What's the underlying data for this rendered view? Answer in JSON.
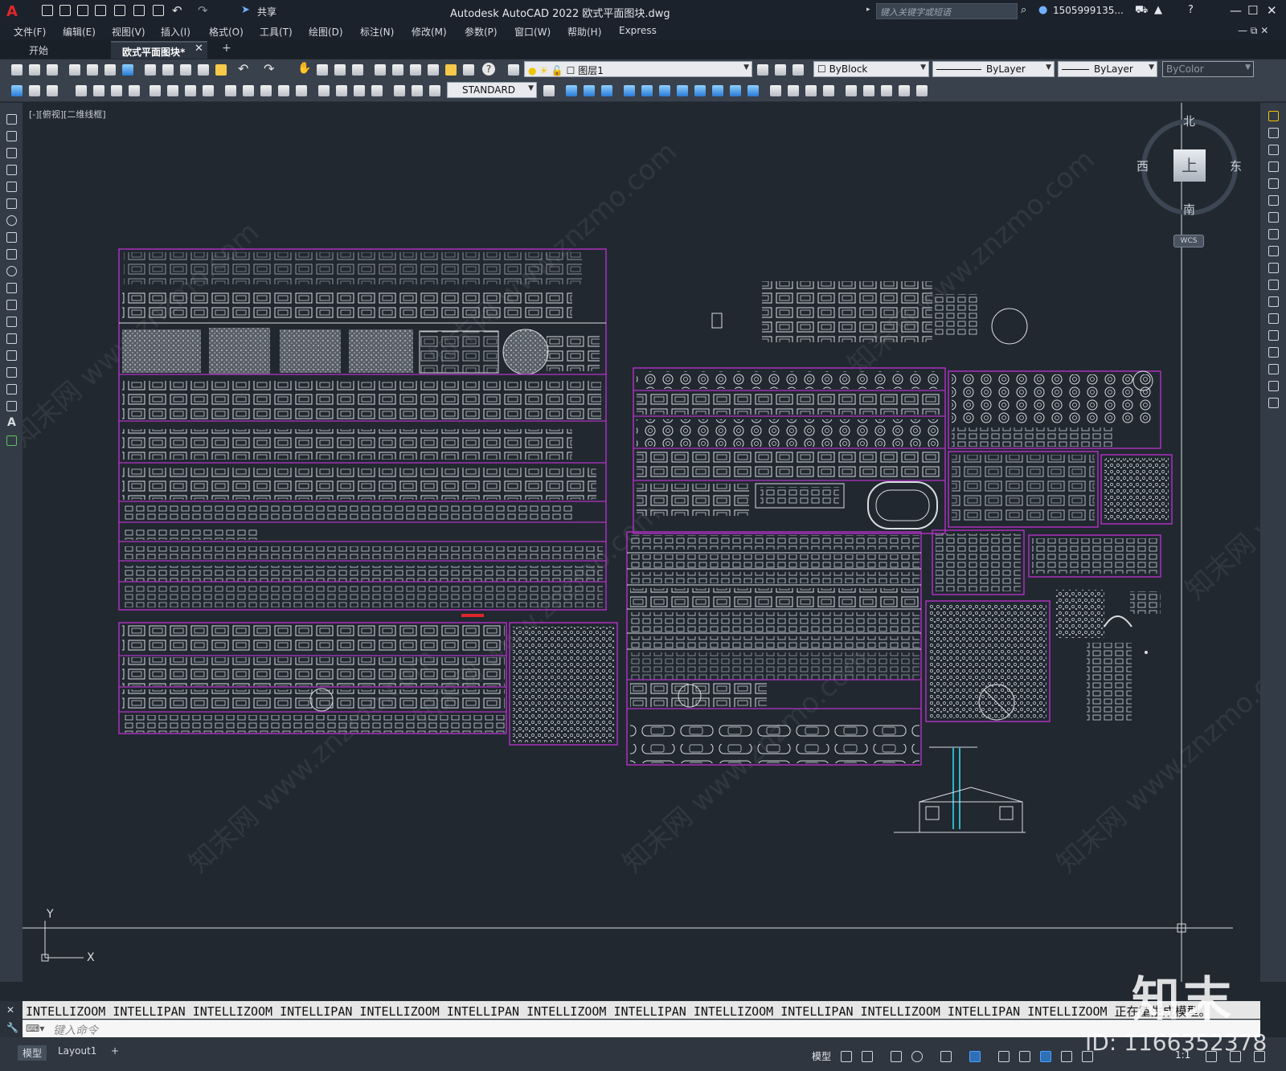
{
  "app": {
    "logo": "A",
    "title": "Autodesk AutoCAD 2022    欧式平面图块.dwg",
    "share": "共享",
    "search_placeholder": "键入关键字或短语",
    "user": "1505999135...",
    "window_buttons": [
      "—",
      "☐",
      "✕"
    ]
  },
  "menu": [
    "文件(F)",
    "编辑(E)",
    "视图(V)",
    "插入(I)",
    "格式(O)",
    "工具(T)",
    "绘图(D)",
    "标注(N)",
    "修改(M)",
    "参数(P)",
    "窗口(W)",
    "帮助(H)",
    "Express"
  ],
  "tabs": {
    "start": "开始",
    "file": "欧式平面图块*",
    "close": "✕",
    "add": "+"
  },
  "toolbar": {
    "layer": "图层1",
    "color": "ByBlock",
    "linetype": "ByLayer",
    "lineweight": "ByLayer",
    "plotstyle": "ByColor",
    "textstyle": "STANDARD"
  },
  "viewport": {
    "label": "[-][俯视][二维线框]",
    "viewcube_face": "上",
    "north": "北",
    "south": "南",
    "east": "东",
    "west": "西",
    "wcs": "WCS",
    "axis_x": "X",
    "axis_y": "Y"
  },
  "command": {
    "history": "INTELLIZOOM INTELLIPAN INTELLIZOOM INTELLIPAN INTELLIZOOM INTELLIPAN INTELLIZOOM INTELLIPAN INTELLIZOOM INTELLIPAN INTELLIZOOM INTELLIPAN INTELLIZOOM 正在重生成模型。",
    "placeholder": "键入命令"
  },
  "status": {
    "model_tab": "模型",
    "layout_tab": "Layout1",
    "add_tab": "+",
    "model_label": "模型",
    "scale": "1:1"
  },
  "watermark": {
    "logo": "知末",
    "id": "ID: 1166352378",
    "diag": "知末网 www.znzmo.com"
  },
  "colors": {
    "background": "#212830",
    "block_frame": "#b431c7",
    "linework": "#d9dde2",
    "accent": "#e0262b"
  }
}
